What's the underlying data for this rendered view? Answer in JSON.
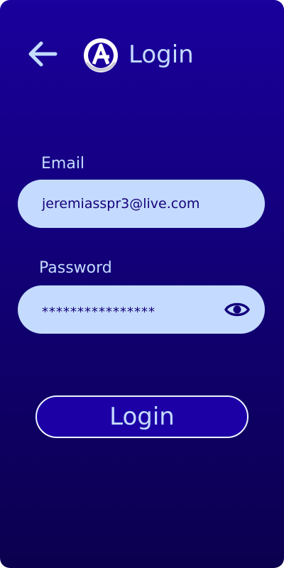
{
  "header": {
    "title": "Login",
    "back_icon": "arrow-left-icon",
    "logo_icon": "logo-mark-icon"
  },
  "form": {
    "email_label": "Email",
    "email_value": "jeremiasspr3@live.com",
    "password_label": "Password",
    "password_value": "****************",
    "password_toggle_icon": "eye-icon",
    "submit_label": "Login"
  },
  "colors": {
    "background_top": "#1a009c",
    "background_bottom": "#0b004f",
    "field_fill": "#c4dbff",
    "text_dark": "#14007a",
    "text_light": "#c4dbff",
    "button_fill": "#1c00a6",
    "button_border": "#eef3ff"
  }
}
